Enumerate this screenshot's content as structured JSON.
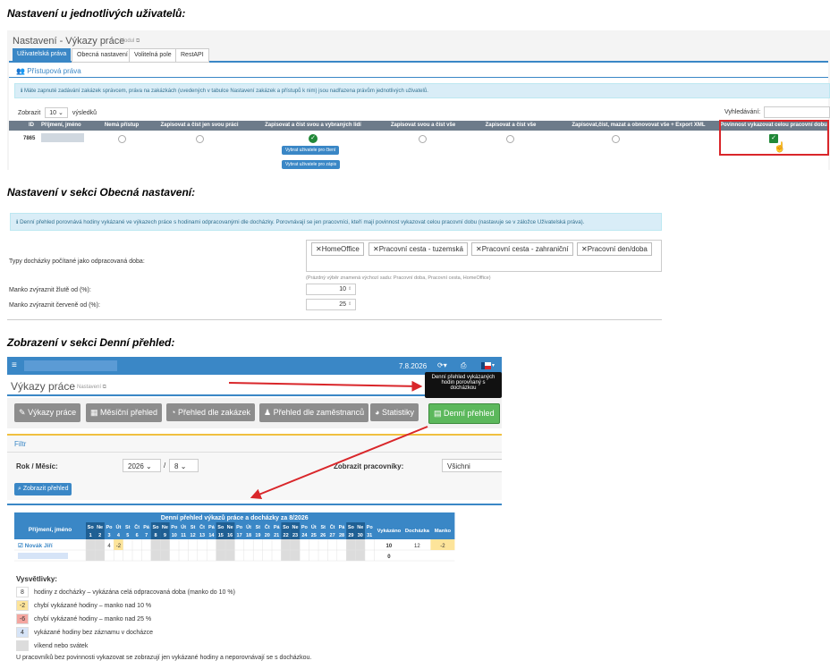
{
  "captions": {
    "c1": "Nastavení u jednotlivých uživatelů:",
    "c2": "Nastavení v sekci Obecná nastavení:",
    "c3": "Zobrazení v sekci Denní přehled:"
  },
  "s1": {
    "title": "Nastavení - Výkazy práce",
    "title_tag": "Modul",
    "tabs": [
      "Uživatelská práva",
      "Obecná nastavení",
      "Volitelná pole",
      "RestAPI"
    ],
    "section": "Přístupová práva",
    "info": "Máte zapnuté zadávání zakázek správcem, práva na zakázkách (uvedených v tabulce Nastavení zakázek a přístupů k nim) jsou nadřazena právům jednotlivých uživatelů.",
    "show_label": "Zobrazit",
    "show_value": "10",
    "show_suffix": "výsledků",
    "search_label": "Vyhledávání:",
    "columns": [
      "ID",
      "Příjmení, jméno",
      "Nemá přístup",
      "Zapisovat a číst jen svou práci",
      "Zapisovat a číst svou a vybraných lidí",
      "Zapisovat svou a číst vše",
      "Zapisovat a číst vše",
      "Zapisovat,číst, mazat a obnovovat vše + Export XML",
      "Povinnost vykazovat celou pracovní dobu"
    ],
    "row_id": "7865",
    "btn_read": "Vybrat uživatele pro čtení",
    "btn_write": "Vybrat uživatele pro zápis"
  },
  "s2": {
    "info": "Denní přehled porovnává hodiny vykázané ve výkazech práce s hodinami odpracovanými dle docházky. Porovnávají se jen pracovníci, kteří mají povinnost vykazovat celou pracovní dobu (nastavuje se v záložce Uživatelská práva).",
    "types_label": "Typy docházky počítané jako odpracovaná doba:",
    "chips": [
      "HomeOffice",
      "Pracovní cesta - tuzemská",
      "Pracovní cesta - zahraniční",
      "Pracovní den/doba"
    ],
    "hint": "(Prázdný výběr znamená výchozí sadu: Pracovní doba, Pracovní cesta, HomeOffice)",
    "yellow_label": "Manko zvýraznit žlutě od (%):",
    "yellow_value": "10",
    "red_label": "Manko zvýraznit červeně od (%):",
    "red_value": "25"
  },
  "s3": {
    "date": "7.8.2026",
    "page_title": "Výkazy práce",
    "settings_link": "Nastavení",
    "tooltip": "Denní přehled vykázaných hodin porovnaný s docházkou",
    "toolbar": [
      "Výkazy práce",
      "Měsíční přehled",
      "Přehled dle zakázek",
      "Přehled dle zaměstnanců",
      "Statistiky",
      "Denní přehled"
    ],
    "filter": "Filtr",
    "period_label": "Rok / Měsíc:",
    "year": "2026",
    "month": "8",
    "workers_label": "Zobrazit pracovníky:",
    "workers_value": "Všichni",
    "show_btn": "Zobrazit přehled",
    "table_title": "Denní přehled výkazů práce a docházky za 8/2026",
    "name_col": "Příjmení, jméno",
    "day_names": [
      "So",
      "Ne",
      "Po",
      "Út",
      "St",
      "Čt",
      "Pá",
      "So",
      "Ne",
      "Po",
      "Út",
      "St",
      "Čt",
      "Pá",
      "So",
      "Ne",
      "Po",
      "Út",
      "St",
      "Čt",
      "Pá",
      "So",
      "Ne",
      "Po",
      "Út",
      "St",
      "Čt",
      "Pá",
      "So",
      "Ne",
      "Po"
    ],
    "weekend_days": [
      1,
      2,
      8,
      9,
      15,
      16,
      22,
      23,
      29,
      30
    ],
    "sum_cols": [
      "Vykázáno",
      "Docházka",
      "Manko"
    ],
    "row1": {
      "name": "Novák Jiří",
      "d3": "4",
      "d4": "-2",
      "vyk": "10",
      "doch": "12",
      "manko": "-2"
    },
    "row2": {
      "vyk": "0"
    },
    "legend_title": "Vysvětlivky:",
    "legend": [
      {
        "v": "8",
        "t": "hodiny z docházky – vykázána celá odpracovaná doba (manko do 10 %)",
        "c": "#ffffff"
      },
      {
        "v": "-2",
        "t": "chybí vykázané hodiny – manko nad 10 %",
        "c": "#fde49a"
      },
      {
        "v": "-6",
        "t": "chybí vykázané hodiny – manko nad 25 %",
        "c": "#f4a6a0"
      },
      {
        "v": "4",
        "t": "vykázané hodiny bez záznamu v docházce",
        "c": "#d6e4f7"
      },
      {
        "v": "",
        "t": "víkend nebo svátek",
        "c": "#dcdcdc"
      }
    ],
    "footnote": "U pracovníků bez povinnosti vykazovat se zobrazují jen vykázané hodiny a neporovnávají se s docházkou."
  },
  "colors": {
    "blue": "#3a87c6",
    "green": "#5cb85c",
    "grey": "#8d8d8d",
    "red": "#d9262a",
    "info": "#d9edf7"
  }
}
